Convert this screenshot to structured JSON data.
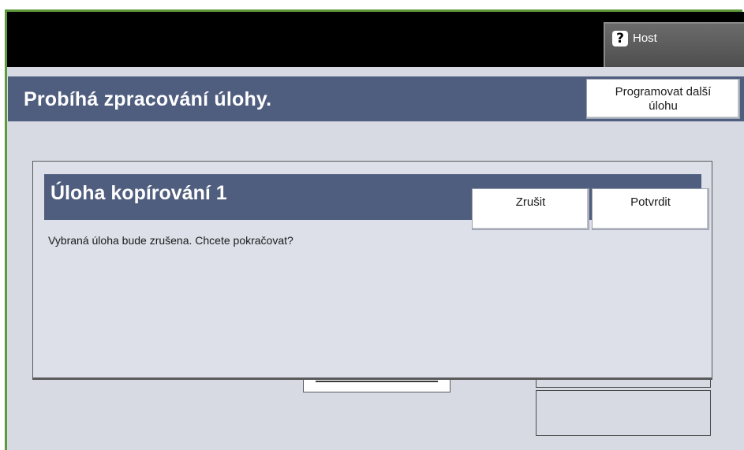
{
  "topbar": {
    "host_label": "Host",
    "host_icon": "help-question-icon",
    "host_icon_glyph": "?"
  },
  "header": {
    "title": "Probíhá zpracování úlohy.",
    "program_next_label": "Programovat další\núlohu"
  },
  "dialog": {
    "title": "Úloha kopírování 1",
    "cancel_label": "Zrušit",
    "confirm_label": "Potvrdit",
    "message": "Vybraná úloha bude zrušena. Chcete pokračovat?"
  },
  "colors": {
    "frame": "#5e9a3c",
    "title_bar": "#4f5d7e",
    "background": "#d7dae3",
    "topbar": "#000000"
  }
}
